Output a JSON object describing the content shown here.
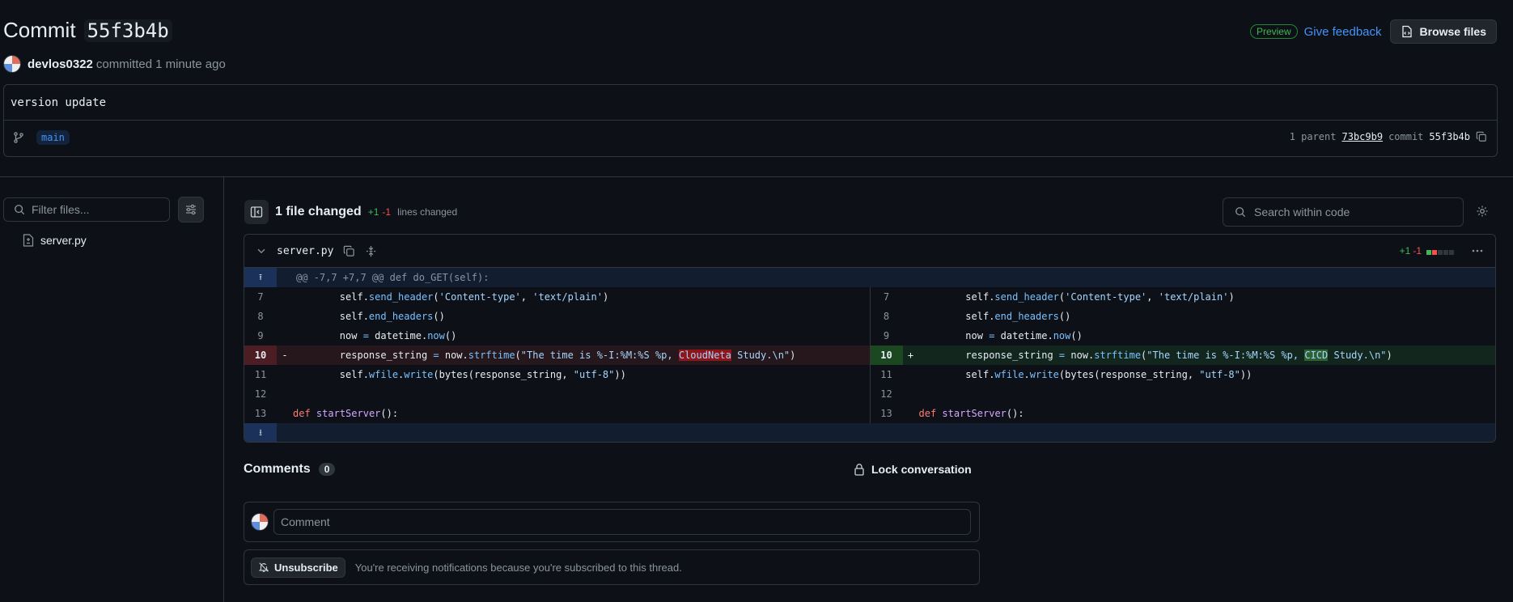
{
  "header": {
    "title_prefix": "Commit",
    "sha_short": "55f3b4b",
    "author": "devlos0322",
    "action": "committed",
    "time": "1 minute ago",
    "preview_badge": "Preview",
    "feedback_link": "Give feedback",
    "browse_button": "Browse files"
  },
  "commit": {
    "message": "version update",
    "branch": "main",
    "parent_label": "1 parent",
    "parent_sha": "73bc9b9",
    "commit_label": "commit",
    "commit_sha": "55f3b4b"
  },
  "sidebar": {
    "filter_placeholder": "Filter files...",
    "files": [
      "server.py"
    ]
  },
  "toolbar": {
    "files_changed": "1 file changed",
    "additions": "+1",
    "deletions": "-1",
    "lines_changed": "lines changed",
    "search_placeholder": "Search within code"
  },
  "diff": {
    "filename": "server.py",
    "additions": "+1",
    "deletions": "-1",
    "hunk_header": "@@ -7,7 +7,7 @@ def do_GET(self):",
    "left": [
      {
        "ln": "7",
        "marker": "",
        "type": "ctx"
      },
      {
        "ln": "8",
        "marker": "",
        "type": "ctx"
      },
      {
        "ln": "9",
        "marker": "",
        "type": "ctx"
      },
      {
        "ln": "10",
        "marker": "-",
        "type": "del"
      },
      {
        "ln": "11",
        "marker": "",
        "type": "ctx"
      },
      {
        "ln": "12",
        "marker": "",
        "type": "ctx"
      },
      {
        "ln": "13",
        "marker": "",
        "type": "ctx"
      }
    ],
    "right": [
      {
        "ln": "7",
        "marker": "",
        "type": "ctx"
      },
      {
        "ln": "8",
        "marker": "",
        "type": "ctx"
      },
      {
        "ln": "9",
        "marker": "",
        "type": "ctx"
      },
      {
        "ln": "10",
        "marker": "+",
        "type": "add"
      },
      {
        "ln": "11",
        "marker": "",
        "type": "ctx"
      },
      {
        "ln": "12",
        "marker": "",
        "type": "ctx"
      },
      {
        "ln": "13",
        "marker": "",
        "type": "ctx"
      }
    ],
    "code": {
      "l7_a": "        self.",
      "l7_b": "send_header",
      "l7_c": "(",
      "l7_d": "'Content-type'",
      "l7_e": ", ",
      "l7_f": "'text/plain'",
      "l7_g": ")",
      "l8_a": "        self.",
      "l8_b": "end_headers",
      "l8_c": "()",
      "l9_a": "        now ",
      "l9_b": "=",
      "l9_c": " datetime.",
      "l9_d": "now",
      "l9_e": "()",
      "l10_a": "        response_string ",
      "l10_b": "=",
      "l10_c": " now.",
      "l10_d": "strftime",
      "l10_e": "(",
      "l10_str_pre": "\"The time is %-I:%M:%S %p, ",
      "l10_old_word": "CloudNeta",
      "l10_new_word": "CICD",
      "l10_str_post": " Study.\\n\"",
      "l10_close": ")",
      "l11_a": "        self.",
      "l11_b": "wfile",
      "l11_c": ".",
      "l11_d": "write",
      "l11_e": "(bytes(response_string, ",
      "l11_f": "\"utf-8\"",
      "l11_g": "))",
      "l13_a": "def",
      "l13_b": " ",
      "l13_c": "startServer",
      "l13_d": "():"
    }
  },
  "comments": {
    "title": "Comments",
    "count": "0",
    "lock_label": "Lock conversation",
    "placeholder": "Comment",
    "unsubscribe": "Unsubscribe",
    "notification_text": "You're receiving notifications because you're subscribed to this thread."
  },
  "colors": {
    "background": "#0d1117",
    "border": "#30363d",
    "accent_blue": "#4493f8",
    "add_green": "#3fb950",
    "del_red": "#f85149"
  }
}
